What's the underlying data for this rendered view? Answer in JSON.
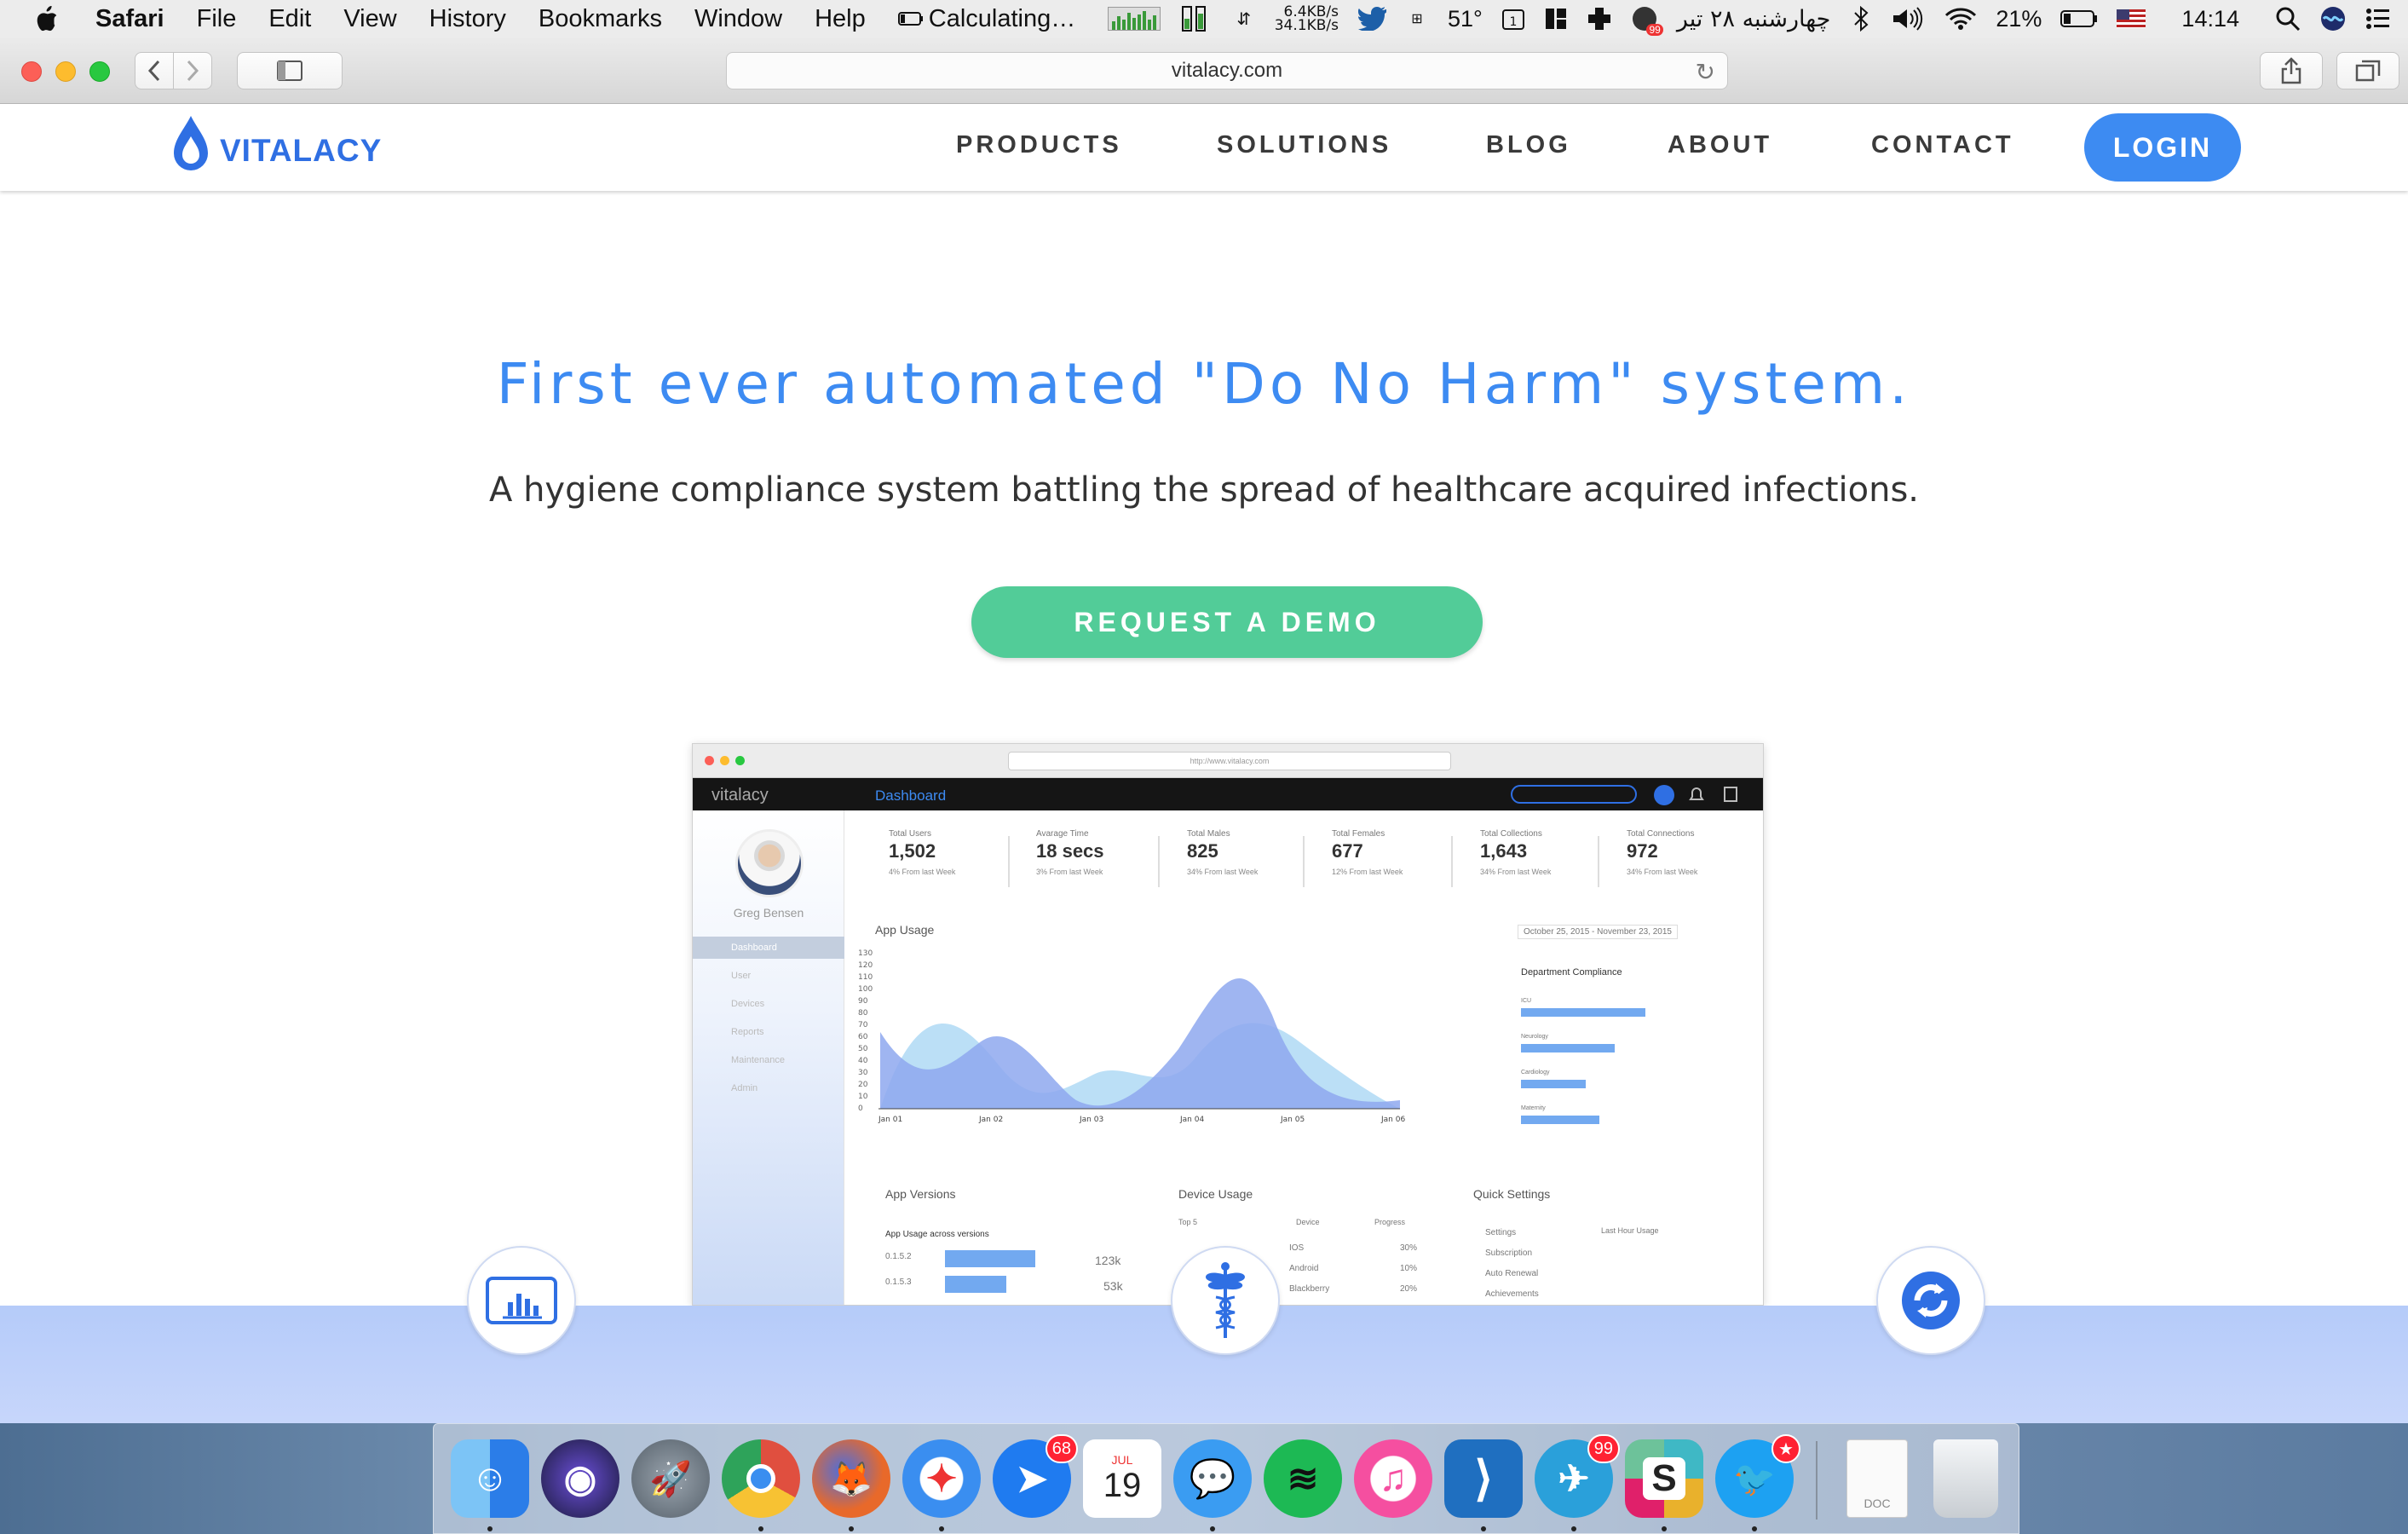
{
  "menubar": {
    "app_name": "Safari",
    "items": [
      "File",
      "Edit",
      "View",
      "History",
      "Bookmarks",
      "Window",
      "Help"
    ],
    "battery_status": "Calculating…",
    "net_down": "6.4KB/s",
    "net_up": "34.1KB/s",
    "temperature": "51°",
    "date_persian": "چهارشنبه ۲۸ تیر",
    "battery_percent": "21%",
    "clock": "14:14",
    "notification_badge": "99"
  },
  "browser": {
    "url": "vitalacy.com"
  },
  "site": {
    "brand": "VITALACY",
    "nav": [
      "PRODUCTS",
      "SOLUTIONS",
      "BLOG",
      "ABOUT",
      "CONTACT"
    ],
    "login_label": "LOGIN",
    "accent_color": "#3d8bf2",
    "cta_color": "#52cc98",
    "hero_title": "First ever automated \"Do No Harm\" system.",
    "hero_subtitle": "A hygiene compliance system battling the spread of healthcare acquired infections.",
    "cta_label": "REQUEST A DEMO"
  },
  "mock_dashboard": {
    "url": "http://www.vitalacy.com",
    "brand": "vitalacy",
    "section": "Dashboard",
    "user_name": "Greg Bensen",
    "side_menu": [
      "Dashboard",
      "User",
      "Devices",
      "Reports",
      "Maintenance",
      "Admin"
    ],
    "stats": [
      {
        "label": "Total Users",
        "value": "1,502",
        "change": "4% From last Week"
      },
      {
        "label": "Avarage Time",
        "value": "18 secs",
        "change": "3% From last Week"
      },
      {
        "label": "Total Males",
        "value": "825",
        "change": "34% From last Week"
      },
      {
        "label": "Total Females",
        "value": "677",
        "change": "12% From last Week"
      },
      {
        "label": "Total Collections",
        "value": "1,643",
        "change": "34% From last Week"
      },
      {
        "label": "Total Connections",
        "value": "972",
        "change": "34% From last Week"
      }
    ],
    "app_usage_title": "App Usage",
    "date_range": "October 25, 2015 - November 23, 2015",
    "y_ticks": [
      "130",
      "120",
      "110",
      "100",
      "90",
      "80",
      "70",
      "60",
      "50",
      "40",
      "30",
      "20",
      "10",
      "0"
    ],
    "x_ticks": [
      "Jan 01",
      "Jan 02",
      "Jan 03",
      "Jan 04",
      "Jan 05",
      "Jan 06"
    ],
    "dept_title": "Department Compliance",
    "departments": [
      {
        "name": "ICU",
        "value": 90
      },
      {
        "name": "Neurology",
        "value": 76
      },
      {
        "name": "Cardiology",
        "value": 50
      },
      {
        "name": "Maternity",
        "value": 62
      }
    ],
    "app_versions_title": "App Versions",
    "app_versions_sub": "App Usage across versions",
    "versions": [
      {
        "name": "0.1.5.2",
        "value": "123k"
      },
      {
        "name": "0.1.5.3",
        "value": "53k"
      }
    ],
    "device_usage_title": "Device Usage",
    "device_headers": [
      "Top 5",
      "Device",
      "Progress"
    ],
    "devices": [
      {
        "name": "IOS",
        "progress": "30%"
      },
      {
        "name": "Android",
        "progress": "10%"
      },
      {
        "name": "Blackberry",
        "progress": "20%"
      }
    ],
    "quick_settings_title": "Quick Settings",
    "quick_settings": [
      "Settings",
      "Subscription",
      "Auto Renewal",
      "Achievements"
    ],
    "last_hour_title": "Last Hour Usage"
  },
  "features": {
    "icons": [
      "tablet-chart-icon",
      "caduceus-icon",
      "sync-icon"
    ]
  },
  "dock": {
    "apps": [
      {
        "name": "finder",
        "color": "#3a8ef0",
        "glyph": "☺",
        "running": true
      },
      {
        "name": "siri",
        "color": "#2c2c5a",
        "glyph": "◉",
        "running": false
      },
      {
        "name": "launchpad",
        "color": "#6d7680",
        "glyph": "🚀",
        "running": false
      },
      {
        "name": "chrome",
        "color": "#e04f3f",
        "glyph": "◎",
        "running": true
      },
      {
        "name": "firefox",
        "color": "#e8692a",
        "glyph": "🦊",
        "running": true
      },
      {
        "name": "safari",
        "color": "#2f8af0",
        "glyph": "✦",
        "running": true
      },
      {
        "name": "maps",
        "color": "#1f7bf0",
        "glyph": "➤",
        "badge": "68",
        "running": false
      },
      {
        "name": "calendar",
        "color": "#ffffff",
        "glyph": "19",
        "running": false
      },
      {
        "name": "messages",
        "color": "#3a9cf2",
        "glyph": "💬",
        "running": true
      },
      {
        "name": "spotify",
        "color": "#1db954",
        "glyph": "≋",
        "running": false
      },
      {
        "name": "itunes",
        "color": "#f54fa0",
        "glyph": "♫",
        "running": false
      },
      {
        "name": "vscode",
        "color": "#1f6fc0",
        "glyph": "⟩",
        "running": true
      },
      {
        "name": "telegram",
        "color": "#2aa0da",
        "glyph": "✈",
        "badge": "99",
        "running": true
      },
      {
        "name": "slack",
        "color": "#e8e8e8",
        "glyph": "S",
        "running": true
      },
      {
        "name": "twitter",
        "color": "#1da1f2",
        "glyph": "🐦",
        "badge": "★",
        "running": true
      }
    ],
    "calendar_month": "JUL",
    "doc_label": "DOC",
    "trash": "trash"
  }
}
